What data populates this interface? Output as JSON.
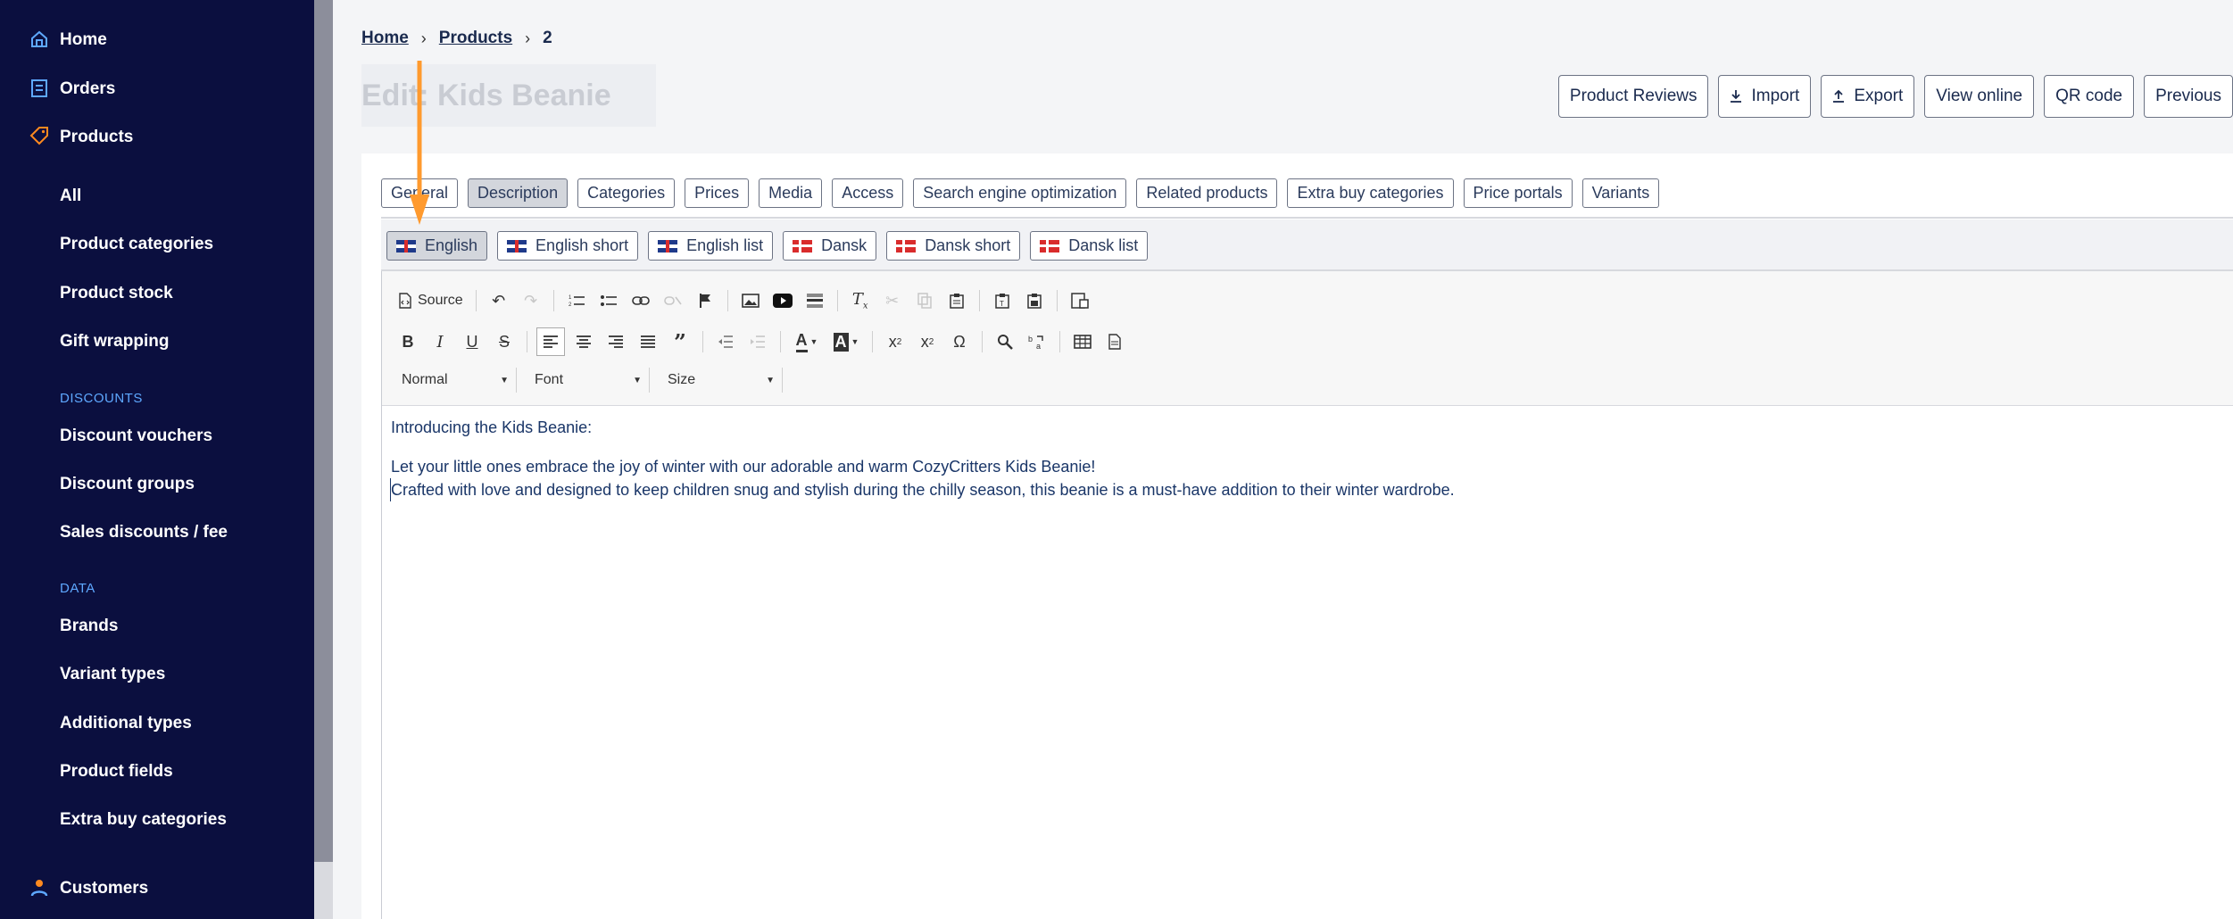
{
  "sidebar": {
    "items_main": [
      {
        "label": "Home",
        "icon": "home-icon"
      },
      {
        "label": "Orders",
        "icon": "orders-icon"
      },
      {
        "label": "Products",
        "icon": "tag-icon"
      }
    ],
    "products_sub": [
      "All",
      "Product categories",
      "Product stock",
      "Gift wrapping"
    ],
    "section_discounts": "DISCOUNTS",
    "discounts": [
      "Discount vouchers",
      "Discount groups",
      "Sales discounts / fee"
    ],
    "section_data": "DATA",
    "data": [
      "Brands",
      "Variant types",
      "Additional types",
      "Product fields",
      "Extra buy categories"
    ],
    "customers": {
      "label": "Customers",
      "icon": "user-icon"
    },
    "colors": {
      "background": "#0b0f3f",
      "accent_orange": "#ff8a1f",
      "section": "#5ea8ff"
    }
  },
  "breadcrumb": {
    "home": "Home",
    "products": "Products",
    "current": "2"
  },
  "page_title": "Edit: Kids Beanie",
  "actions": [
    "Product Reviews",
    "Import",
    "Export",
    "View online",
    "QR code",
    "Previous"
  ],
  "tabs": [
    "General",
    "Description",
    "Categories",
    "Prices",
    "Media",
    "Access",
    "Search engine optimization",
    "Related products",
    "Extra buy categories",
    "Price portals",
    "Variants"
  ],
  "active_tab": "Description",
  "lang_tabs": [
    {
      "label": "English",
      "flag": "uk-flag"
    },
    {
      "label": "English short",
      "flag": "uk-flag"
    },
    {
      "label": "English list",
      "flag": "uk-flag"
    },
    {
      "label": "Dansk",
      "flag": "dk-flag"
    },
    {
      "label": "Dansk short",
      "flag": "dk-flag"
    },
    {
      "label": "Dansk list",
      "flag": "dk-flag"
    }
  ],
  "active_lang": "English",
  "editor": {
    "source_label": "Source",
    "format_combo": "Normal",
    "font_combo": "Font",
    "size_combo": "Size",
    "content": [
      "Introducing the Kids Beanie:",
      "",
      "Let your little ones embrace the joy of winter with our adorable and warm CozyCritters Kids Beanie!",
      "Crafted with love and designed to keep children snug and stylish during the chilly season, this beanie is a must-have addition to their winter wardrobe."
    ]
  }
}
